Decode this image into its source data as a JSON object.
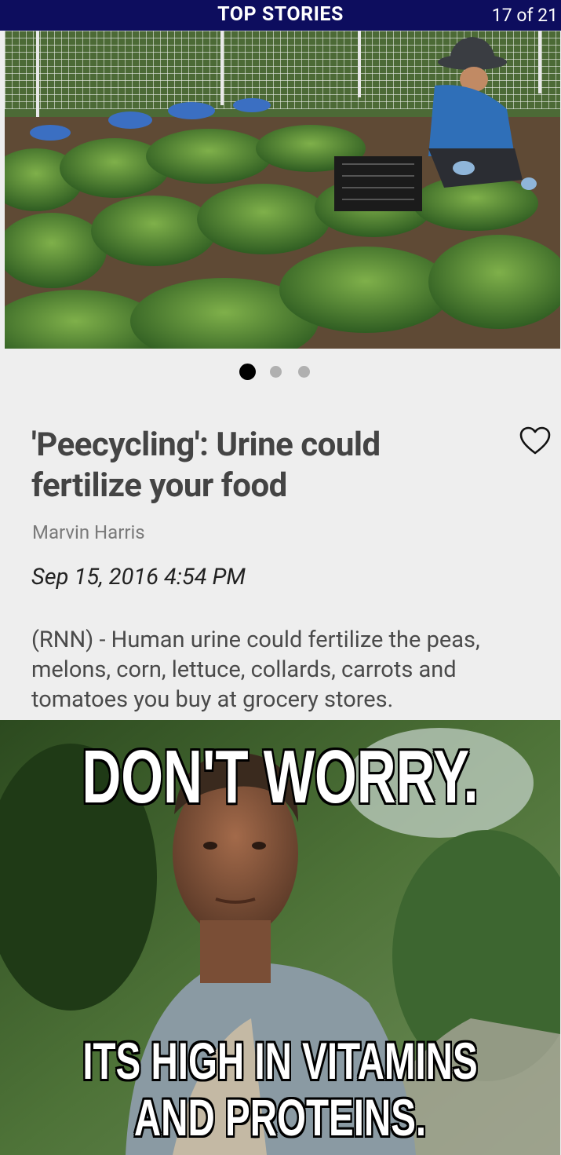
{
  "header": {
    "title": "TOP STORIES",
    "counter": "17 of 21"
  },
  "carousel": {
    "active_index": 0,
    "total": 3
  },
  "article": {
    "headline": "'Peecycling': Urine could fertilize your food",
    "author": "Marvin Harris",
    "date": "Sep 15, 2016 4:54 PM",
    "summary": "(RNN) - Human urine could fertilize the peas, melons, corn, lettuce, collards, carrots and tomatoes you buy at grocery stores."
  },
  "meme": {
    "top_text": "DON'T WORRY.",
    "bottom_text": "ITS HIGH IN VITAMINS AND PROTEINS."
  },
  "icons": {
    "favorite": "heart-outline-icon"
  },
  "colors": {
    "header_bg": "#0d0d5e",
    "dot_active": "#000000",
    "dot_inactive": "#b0b0b0"
  }
}
